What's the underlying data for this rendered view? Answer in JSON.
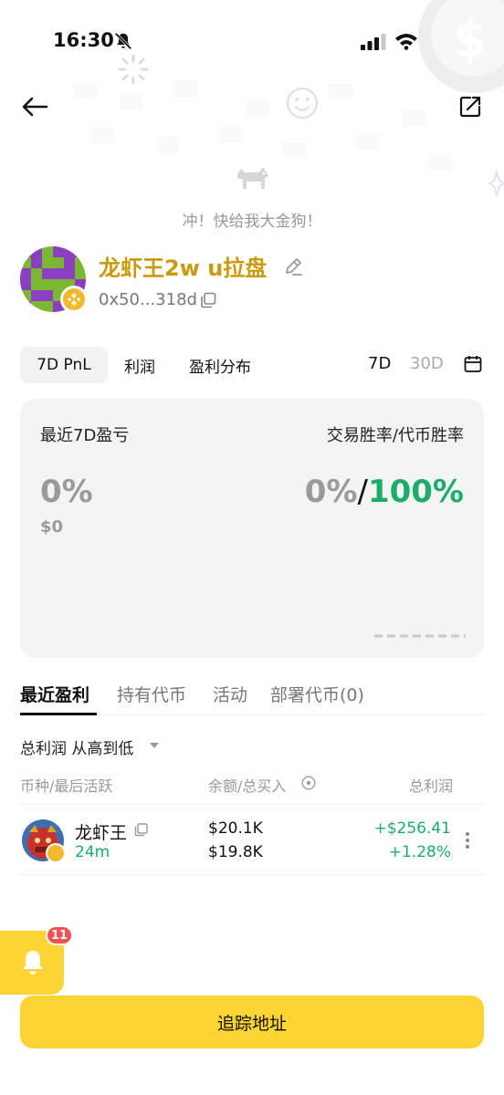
{
  "status_bar": {
    "time": "16:30"
  },
  "header": {
    "back_icon": "back-arrow-icon",
    "share_icon": "share-icon"
  },
  "profile": {
    "slogan": "冲！快给我大金狗！",
    "name": "龙虾王2w u拉盘",
    "address": "0x50...318d",
    "chain_icon": "bnb-chain-icon"
  },
  "tabs": [
    "7D PnL",
    "利润",
    "盈利分布"
  ],
  "ranges": [
    "7D",
    "30D"
  ],
  "card": {
    "left_label": "最近7D盈亏",
    "right_label": "交易胜率/代币胜率",
    "pnl_percent": "0%",
    "pnl_usd": "$0",
    "trade_winrate": "0%",
    "separator": "/",
    "token_winrate": "100%"
  },
  "sub_tabs": [
    "最近盈利",
    "持有代币",
    "活动",
    "部署代币(0)"
  ],
  "sort_label": "总利润 从高到低",
  "table": {
    "headers": [
      "币种/最后活跃",
      "余额/总买入",
      "总利润"
    ],
    "rows": [
      {
        "name": "龙虾王",
        "last_active": "24m",
        "balance": "$20.1K",
        "total_buy": "$19.8K",
        "profit": "+$256.41",
        "profit_pct": "+1.28%"
      }
    ]
  },
  "notifications": {
    "count": "11"
  },
  "track_button": "追踪地址",
  "colors": {
    "accent": "#fcd535",
    "gold_text": "#c99a0d",
    "positive": "#1eac6a"
  }
}
